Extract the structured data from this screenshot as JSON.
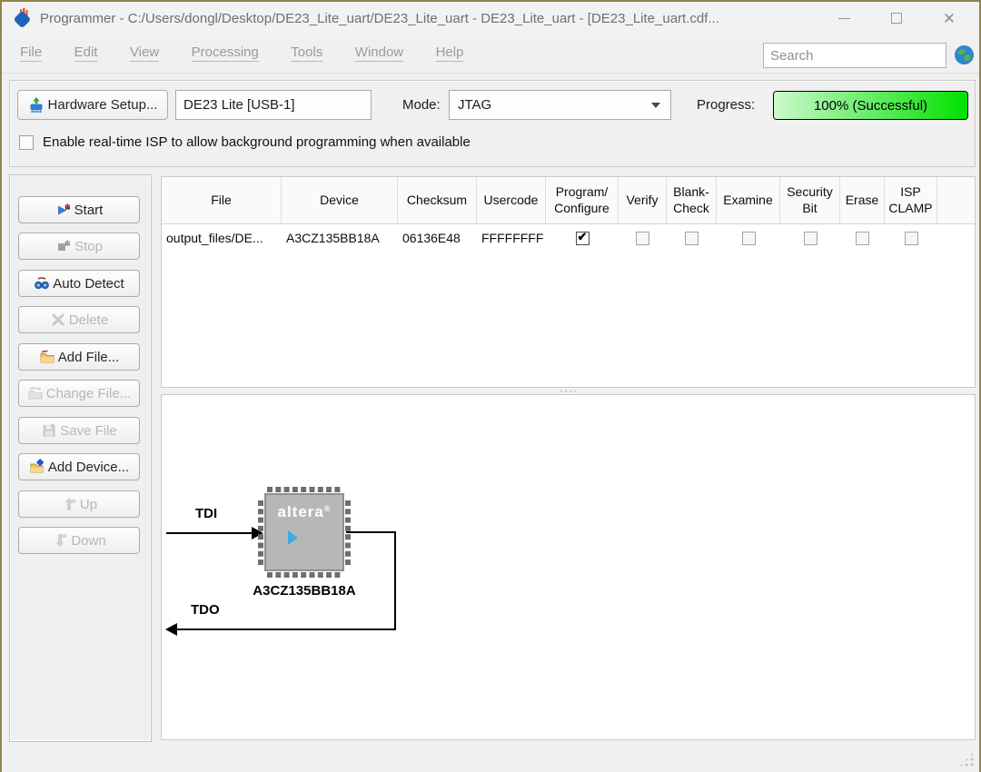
{
  "window": {
    "title": "Programmer - C:/Users/dongl/Desktop/DE23_Lite_uart/DE23_Lite_uart - DE23_Lite_uart - [DE23_Lite_uart.cdf..."
  },
  "menu": {
    "items": [
      {
        "label": "File"
      },
      {
        "label": "Edit"
      },
      {
        "label": "View"
      },
      {
        "label": "Processing"
      },
      {
        "label": "Tools"
      },
      {
        "label": "Window"
      },
      {
        "label": "Help"
      }
    ]
  },
  "search": {
    "placeholder": "Search"
  },
  "toolbar": {
    "hardware_setup_label": "Hardware Setup...",
    "hardware_name": "DE23 Lite [USB-1]",
    "mode_label": "Mode:",
    "mode_value": "JTAG",
    "progress_label": "Progress:",
    "progress_text": "100% (Successful)",
    "progress_percent": 100
  },
  "isp_checkbox": {
    "label": "Enable real-time ISP to allow background programming when available",
    "checked": false
  },
  "sidebar": {
    "buttons": [
      {
        "label": "Start",
        "enabled": true,
        "icon": "start-icon"
      },
      {
        "label": "Stop",
        "enabled": false,
        "icon": "stop-icon"
      },
      {
        "label": "Auto Detect",
        "enabled": true,
        "icon": "auto-detect-icon"
      },
      {
        "label": "Delete",
        "enabled": false,
        "icon": "delete-icon"
      },
      {
        "label": "Add File...",
        "enabled": true,
        "icon": "add-file-icon"
      },
      {
        "label": "Change File...",
        "enabled": false,
        "icon": "change-file-icon"
      },
      {
        "label": "Save File",
        "enabled": false,
        "icon": "save-file-icon"
      },
      {
        "label": "Add Device...",
        "enabled": true,
        "icon": "add-device-icon"
      },
      {
        "label": "Up",
        "enabled": false,
        "icon": "up-arrow-icon"
      },
      {
        "label": "Down",
        "enabled": false,
        "icon": "down-arrow-icon"
      }
    ]
  },
  "table": {
    "columns": [
      "File",
      "Device",
      "Checksum",
      "Usercode",
      "Program/\nConfigure",
      "Verify",
      "Blank-\nCheck",
      "Examine",
      "Security\nBit",
      "Erase",
      "ISP\nCLAMP"
    ],
    "rows": [
      {
        "file": "output_files/DE...",
        "device": "A3CZ135BB18A",
        "checksum": "06136E48",
        "usercode": "FFFFFFFF",
        "program_configure": true,
        "verify": false,
        "blank_check": false,
        "examine": false,
        "security_bit": false,
        "erase": false,
        "isp_clamp": false
      }
    ]
  },
  "device_view": {
    "tdi_label": "TDI",
    "tdo_label": "TDO",
    "chip_logo": "altera",
    "chip_name": "A3CZ135BB18A"
  },
  "colors": {
    "progress_green": "#00e100",
    "progress_green_light": "#cdf8cd",
    "chip_body": "#b7b7b7",
    "altera_triangle": "#3fa9e0",
    "window_border": "#90854a"
  }
}
